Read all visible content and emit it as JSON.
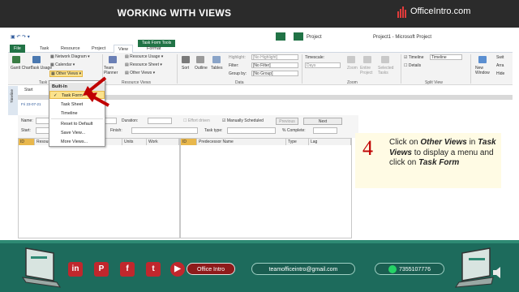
{
  "banner": {
    "title": "WORKING WITH VIEWS",
    "brand": "OfficeIntro.com"
  },
  "window": {
    "app_name": "Project",
    "title": "Project1 - Microsoft Project",
    "tabs": [
      "File",
      "Task",
      "Resource",
      "Project",
      "View",
      "Format"
    ],
    "tools_tab": "Task Form Tools",
    "active_tab": "View"
  },
  "ribbon": {
    "gantt": "Gantt Chart",
    "task_usage": "Task Usage",
    "network": "Network Diagram",
    "calendar": "Calendar",
    "other_views": "Other Views",
    "group_task_views": "Task Views",
    "team_planner": "Team Planner",
    "resource_usage": "Resource Usage",
    "resource_sheet": "Resource Sheet",
    "resource_other": "Other Views",
    "group_resource_views": "Resource Views",
    "sort": "Sort",
    "outline": "Outline",
    "tables": "Tables",
    "highlight_label": "Highlight:",
    "highlight_val": "[No Highlight]",
    "filter_label": "Filter:",
    "filter_val": "[No Filter]",
    "groupby_label": "Group by:",
    "groupby_val": "[No Group]",
    "group_data": "Data",
    "timescale_label": "Timescale:",
    "timescale_val": "Days",
    "zoom": "Zoom",
    "entire_project": "Entire Project",
    "selected_tasks": "Selected Tasks",
    "group_zoom": "Zoom",
    "timeline_chk": "Timeline",
    "timeline_val": "Timeline",
    "details_chk": "Details",
    "group_split": "Split View",
    "new_window": "New Window",
    "switch": "Swit",
    "arrange": "Arra",
    "hide": "Hide"
  },
  "timeline": {
    "strip": "Timeline",
    "start_label": "Start",
    "start_date": "Fri 23-07-21"
  },
  "task_form": {
    "name": "Name:",
    "duration": "Duration:",
    "effort_driven": "Effort driven",
    "manually_scheduled": "Manually Scheduled",
    "previous": "Previous",
    "next": "Next",
    "start": "Start:",
    "finish": "Finish:",
    "task_type": "Task type:",
    "complete": "% Complete:"
  },
  "grid_left": {
    "cols": [
      "ID",
      "Resource Name",
      "Units",
      "Work"
    ]
  },
  "grid_right": {
    "cols": [
      "ID",
      "Predecessor Name",
      "Type",
      "Lag"
    ]
  },
  "menu": {
    "header": "Built-In",
    "items": [
      "Task Form",
      "Task Sheet",
      "Timeline",
      "Reset to Default",
      "Save View...",
      "More Views..."
    ]
  },
  "instruction": {
    "step": "4",
    "text_html": "Click on <b><i>Other Views</i></b> in <b><i>Task Views</i></b> to display a menu and click on <b><i>Task Form</i></b>"
  },
  "footer": {
    "office_intro": "Office Intro",
    "email": "teamofficeintro@gmail.com",
    "phone": "7355107776"
  }
}
